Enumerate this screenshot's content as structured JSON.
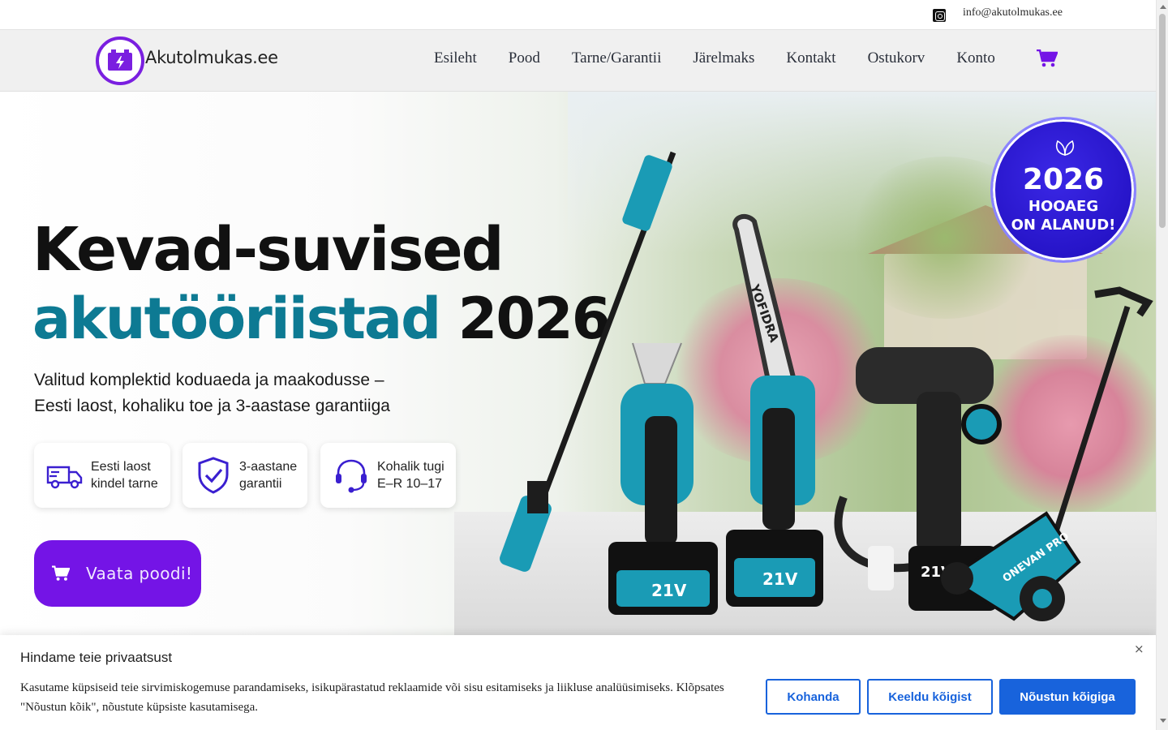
{
  "topbar": {
    "email": "info@akutolmukas.ee",
    "social_icon": "instagram-icon"
  },
  "header": {
    "logo_text": "Akutolmukas.ee",
    "logo_icon": "battery-bolt-icon",
    "nav": [
      "Esileht",
      "Pood",
      "Tarne/Garantii",
      "Järelmaks",
      "Kontakt",
      "Ostukorv",
      "Konto"
    ],
    "cart_icon": "cart-icon"
  },
  "hero": {
    "title_line1": "Kevad-suvised",
    "title_line2_accent": "akutööriistad",
    "title_line2_rest": "2026",
    "subtitle_line1": "Valitud komplektid koduaeda ja maakodusse –",
    "subtitle_line2": "Eesti laost, kohaliku toe ja 3-aastase garantiiga",
    "features": [
      {
        "icon": "truck-icon",
        "line1": "Eesti laost",
        "line2": "kindel tarne"
      },
      {
        "icon": "shield-check-icon",
        "line1": "3-aastane",
        "line2": "garantii"
      },
      {
        "icon": "headset-icon",
        "line1": "Kohalik tugi",
        "line2": "E–R 10–17"
      }
    ],
    "cta_label": "Vaata poodi!",
    "badge": {
      "year": "2026",
      "line1": "HOOAEG",
      "line2": "ON ALANUD!"
    },
    "tool_labels": {
      "battery": "21V",
      "brand1": "YOFIDRA",
      "brand2": "ONEVAN PRO"
    }
  },
  "cookie": {
    "title": "Hindame teie privaatsust",
    "text": "Kasutame küpsiseid teie sirvimiskogemuse parandamiseks, isikupärastatud reklaamide või sisu esitamiseks ja liikluse analüüsimiseks. Klõpsates \"Nõustun kõik\", nõustute küpsiste kasutamisega.",
    "btn_customize": "Kohanda",
    "btn_reject": "Keeldu kõigist",
    "btn_accept": "Nõustun kõigiga",
    "close": "×"
  },
  "colors": {
    "brand_purple": "#7414e6",
    "accent_teal": "#0d7a93",
    "cookie_blue": "#1863dc",
    "badge_blue": "#2614c8"
  }
}
